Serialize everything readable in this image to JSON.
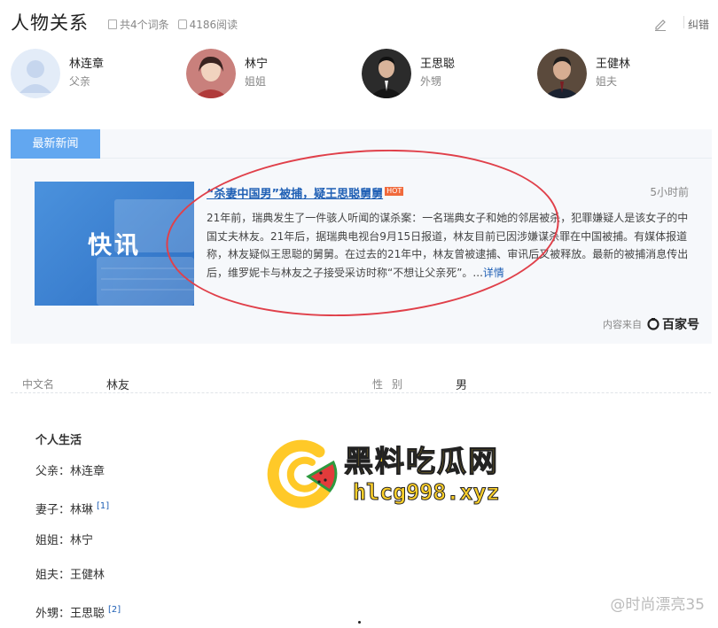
{
  "header": {
    "title": "人物关系",
    "entries_text": "共4个词条",
    "reads_text": "4186阅读",
    "correct_label": "纠错"
  },
  "relations": [
    {
      "name": "林连章",
      "role": "父亲"
    },
    {
      "name": "林宁",
      "role": "姐姐"
    },
    {
      "name": "王思聪",
      "role": "外甥"
    },
    {
      "name": "王健林",
      "role": "姐夫"
    }
  ],
  "news": {
    "tab_label": "最新新闻",
    "thumb_label": "快讯",
    "headline": "“杀妻中国男”被捕，疑王思聪舅舅",
    "hot_badge": "HOT",
    "time": "5小时前",
    "body": "21年前，瑞典发生了一件骇人听闻的谋杀案：一名瑞典女子和她的邻居被杀，犯罪嫌疑人是该女子的中国丈夫林友。21年后，据瑞典电视台9月15日报道，林友目前已因涉嫌谋杀罪在中国被捕。有媒体报道称，林友疑似王思聪的舅舅。在过去的21年中，林友曾被逮捕、审讯后又被释放。最新的被捕消息传出后，维罗妮卡与林友之子接受采访时称“不想让父亲死”。...",
    "detail_label": "详情",
    "source_prefix": "内容来自",
    "source_name": "百家号"
  },
  "basic_info": {
    "chinese_name_label": "中文名",
    "chinese_name_value": "林友",
    "gender_label": "性别",
    "gender_value": "男"
  },
  "personal_life": {
    "title": "个人生活",
    "rows": [
      {
        "text": "父亲：林连章",
        "ref": ""
      },
      {
        "text": "妻子：林琳",
        "ref": "[1]"
      },
      {
        "text": "姐姐：林宁",
        "ref": ""
      },
      {
        "text": "姐夫：王健林",
        "ref": ""
      },
      {
        "text": "外甥：王思聪",
        "ref": "[2]"
      }
    ]
  },
  "watermark": {
    "line1": "黑料吃瓜网",
    "line2": "hlcg998.xyz",
    "credit": "@时尚漂亮35"
  },
  "colors": {
    "tab_blue": "#62a7f0",
    "link_blue": "#2060b5",
    "annotation_red": "#e0404a",
    "watermark_yellow": "#ffd12a"
  }
}
